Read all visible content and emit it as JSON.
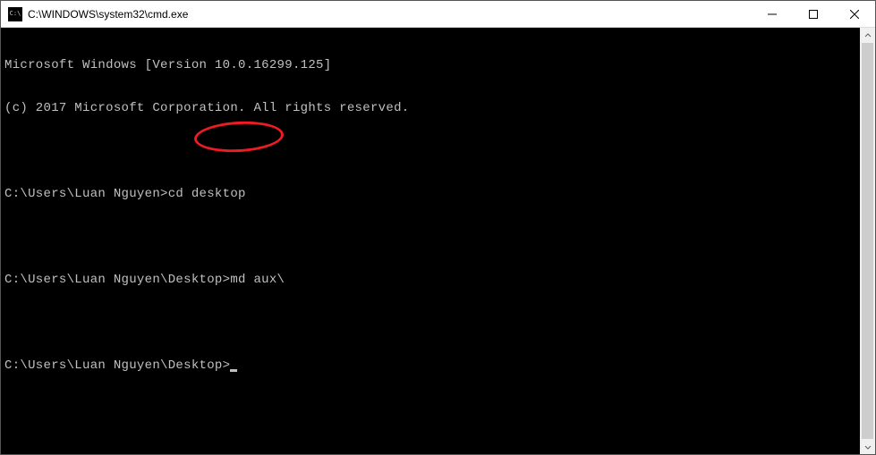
{
  "titlebar": {
    "icon_text": "C:\\",
    "title": "C:\\WINDOWS\\system32\\cmd.exe"
  },
  "terminal": {
    "lines": [
      "Microsoft Windows [Version 10.0.16299.125]",
      "(c) 2017 Microsoft Corporation. All rights reserved.",
      "",
      "C:\\Users\\Luan Nguyen>cd desktop",
      "",
      "C:\\Users\\Luan Nguyen\\Desktop>md aux\\",
      "",
      "C:\\Users\\Luan Nguyen\\Desktop>"
    ]
  },
  "annotation": {
    "highlighted_command": "md aux\\"
  }
}
